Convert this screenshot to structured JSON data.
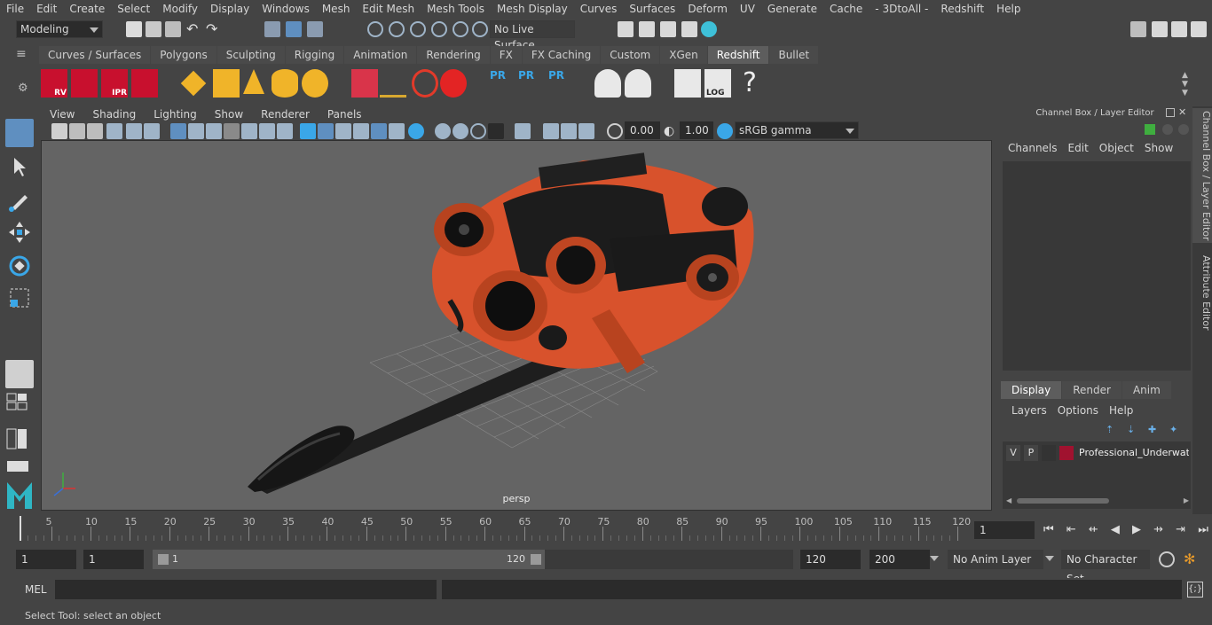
{
  "menu": [
    "File",
    "Edit",
    "Create",
    "Select",
    "Modify",
    "Display",
    "Windows",
    "Mesh",
    "Edit Mesh",
    "Mesh Tools",
    "Mesh Display",
    "Curves",
    "Surfaces",
    "Deform",
    "UV",
    "Generate",
    "Cache",
    "- 3DtoAll -",
    "Redshift",
    "Help"
  ],
  "status": {
    "mode": "Modeling",
    "live_surface": "No Live Surface"
  },
  "shelf_tabs": [
    "Curves / Surfaces",
    "Polygons",
    "Sculpting",
    "Rigging",
    "Animation",
    "Rendering",
    "FX",
    "FX Caching",
    "Custom",
    "XGen",
    "Redshift",
    "Bullet"
  ],
  "shelf_active": "Redshift",
  "shelf_icons": {
    "rv": "RV",
    "ipr": "IPR",
    "pr": "PR",
    "log": "LOG",
    "help": "?"
  },
  "viewport": {
    "menu": [
      "View",
      "Shading",
      "Lighting",
      "Show",
      "Renderer",
      "Panels"
    ],
    "exposure": "0.00",
    "gamma": "1.00",
    "color_space": "sRGB gamma",
    "camera": "persp"
  },
  "channel_box": {
    "title": "Channel Box / Layer Editor",
    "menu": [
      "Channels",
      "Edit",
      "Object",
      "Show"
    ]
  },
  "layer_editor": {
    "tabs": [
      "Display",
      "Render",
      "Anim"
    ],
    "active_tab": "Display",
    "menu": [
      "Layers",
      "Options",
      "Help"
    ],
    "layer": {
      "v": "V",
      "p": "P",
      "name": "Professional_Underwate",
      "color": "#a0122f"
    }
  },
  "side_tabs": [
    "Channel Box / Layer Editor",
    "Attribute Editor"
  ],
  "timeline": {
    "ticks": [
      5,
      10,
      15,
      20,
      25,
      30,
      35,
      40,
      45,
      50,
      55,
      60,
      65,
      70,
      75,
      80,
      85,
      90,
      95,
      100,
      105,
      110,
      115,
      120
    ],
    "start_label": "1",
    "current_frame": "1"
  },
  "range": {
    "start": "1",
    "playback_start": "1",
    "slider_start": "1",
    "slider_end": "120",
    "playback_end": "120",
    "end": "200",
    "anim_layer": "No Anim Layer",
    "character_set": "No Character Set"
  },
  "command": {
    "lang": "MEL"
  },
  "help_line": "Select Tool: select an object",
  "colors": {
    "accent_red": "#c8102e",
    "rov_orange": "#d8522c",
    "viewport_bg": "#646464"
  }
}
